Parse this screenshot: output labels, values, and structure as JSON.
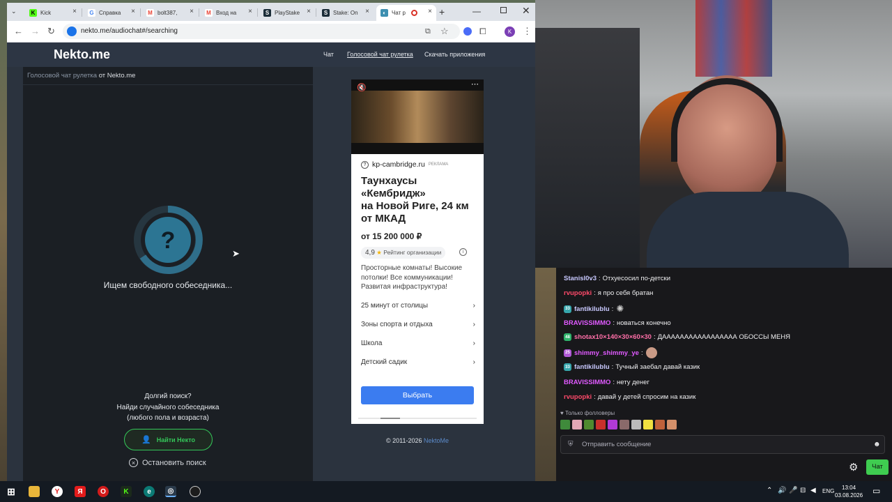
{
  "browser": {
    "tabs": [
      {
        "title": "Kick",
        "icon": "kick-icon",
        "color": "#53fc18"
      },
      {
        "title": "Справка",
        "icon": "google-icon",
        "color": "#4285f4"
      },
      {
        "title": "bolt387,",
        "icon": "gmail-icon",
        "color": "#ea4335"
      },
      {
        "title": "Вход на",
        "icon": "gmail-icon",
        "color": "#ea4335"
      },
      {
        "title": "PlayStake",
        "icon": "stake-icon",
        "color": "#1a2c38"
      },
      {
        "title": "Stake: On",
        "icon": "stake-icon",
        "color": "#1a2c38"
      },
      {
        "title": "Чат р",
        "icon": "nekto-icon",
        "color": "#3d8fb0",
        "active": true
      }
    ],
    "url": "nekto.me/audiochat#/searching",
    "profile_initial": "K"
  },
  "site": {
    "logo": "Nekto.me",
    "nav": [
      "Чат",
      "Голосовой чат рулетка",
      "Скачать приложения"
    ],
    "breadcrumb_link": "Голосовой чат рулетка",
    "breadcrumb_suffix": "от Nekto.me",
    "searching_text": "Ищем свободного собеседника...",
    "long_search": [
      "Долгий поиск?",
      "Найди случайного собеседника",
      "(любого пола и возраста)"
    ],
    "find_button": "Найти Некто",
    "stop_button": "Остановить поиск",
    "copyright": "© 2011-2026",
    "copyright_link": "NektoMe"
  },
  "ad": {
    "domain": "kp-cambridge.ru",
    "ad_label": "РЕКЛАМА",
    "title_lines": [
      "Таунхаусы",
      "«Кембридж»",
      "на Новой Риге, 24 км",
      "от МКАД"
    ],
    "price": "от 15 200 000 ₽",
    "rating": "4,9",
    "rating_label": "Рейтинг организации",
    "description": [
      "Просторные комнаты! Высокие",
      "потолки! Все коммуникации!",
      "Развитая инфраструктура!"
    ],
    "links": [
      "25 минут от столицы",
      "Зоны спорта и отдыха",
      "Школа",
      "Детский садик"
    ],
    "button": "Выбрать"
  },
  "chat": {
    "messages": [
      {
        "user": "Stanisl0v3",
        "color": "#c9c9ff",
        "text": "Отхуесосил по-детски"
      },
      {
        "user": "rvupopki",
        "color": "#ff4a6a",
        "text": "я про себя братан"
      },
      {
        "user": "fantikilublu",
        "color": "#c9c9ff",
        "badge": "33",
        "text": ""
      },
      {
        "user": "BRAVISSIMMO",
        "color": "#e05aff",
        "text": "новаться конечно"
      },
      {
        "user": "shotax10×140×30×60×30",
        "color": "#ff6fa8",
        "badge": "48",
        "text": "ДААААААААААААААААА ОБОССЫ МЕНЯ"
      },
      {
        "user": "shimmy_shimmy_ye",
        "color": "#e05aff",
        "badge": "25",
        "text": ""
      },
      {
        "user": "fantikilublu",
        "color": "#c9c9ff",
        "badge": "33",
        "text": "Тучный заебал давай казик"
      },
      {
        "user": "BRAVISSIMMO",
        "color": "#e05aff",
        "text": "нету денег"
      },
      {
        "user": "rvupopki",
        "color": "#ff4a6a",
        "text": "давай у детей спросим на казик"
      }
    ],
    "followers_only": "Только фолловеры",
    "input_placeholder": "Отправить сообщение",
    "send_button": "Чат"
  },
  "taskbar": {
    "lang": "ENG",
    "time": "13:04",
    "date": "03.08.2026"
  }
}
